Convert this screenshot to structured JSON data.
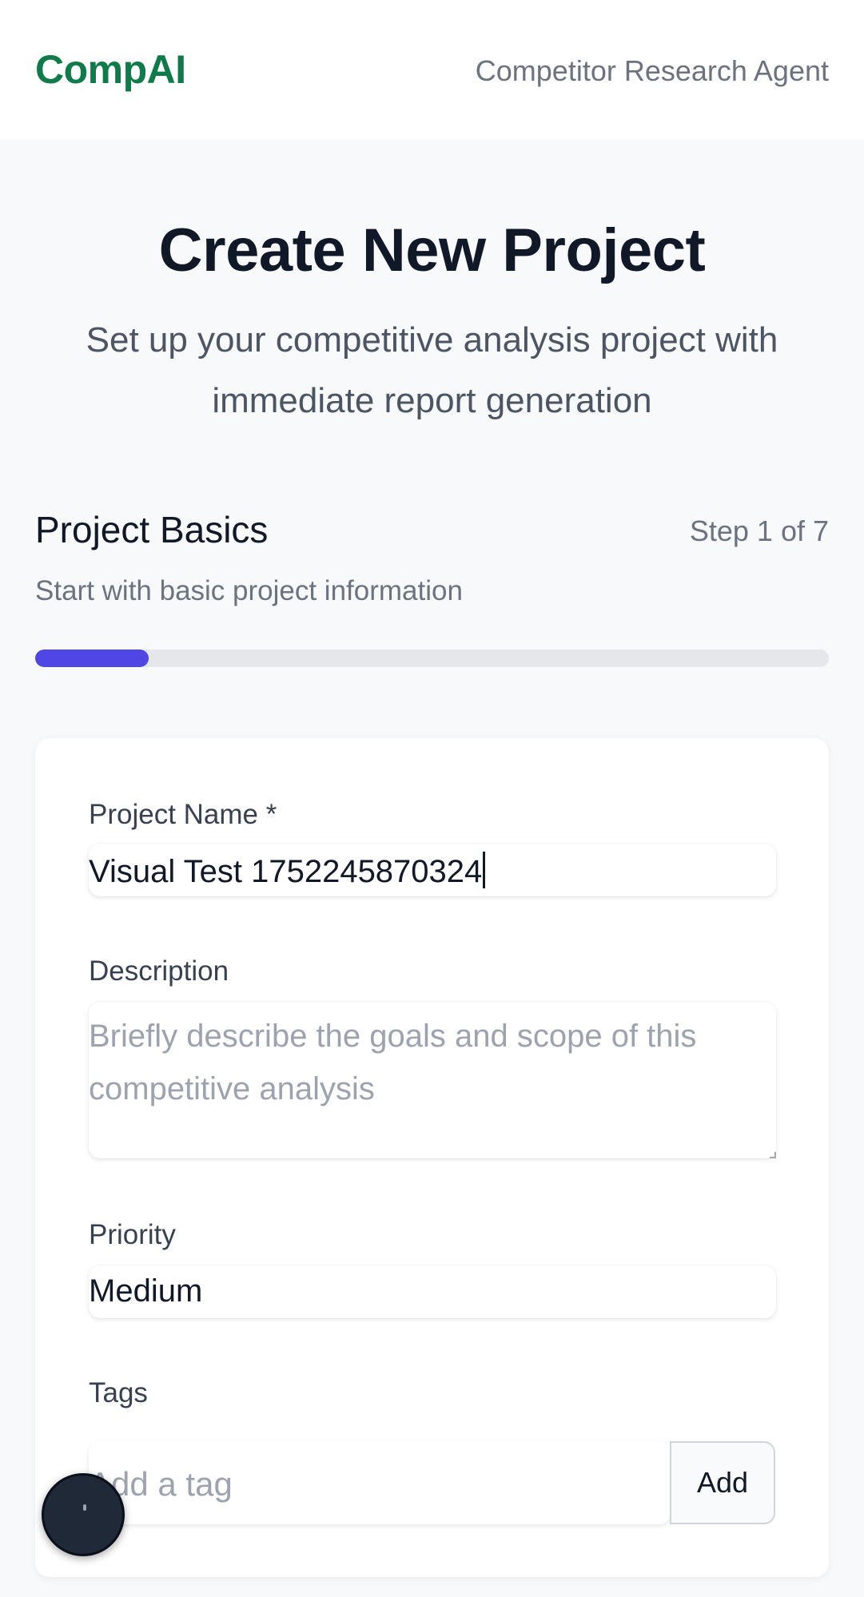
{
  "header": {
    "brand": "CompAI",
    "subtitle": "Competitor Research Agent"
  },
  "hero": {
    "title": "Create New Project",
    "subtitle": "Set up your competitive analysis project with immediate report generation"
  },
  "step": {
    "title": "Project Basics",
    "counter": "Step 1 of 7",
    "description": "Start with basic project information",
    "progress_fraction": 0.143
  },
  "form": {
    "project_name": {
      "label": "Project Name *",
      "value": "Visual Test 1752245870324"
    },
    "description": {
      "label": "Description",
      "placeholder": "Briefly describe the goals and scope of this competitive analysis"
    },
    "priority": {
      "label": "Priority",
      "value": "Medium"
    },
    "tags": {
      "label": "Tags",
      "placeholder": "Add a tag",
      "add_label": "Add"
    }
  },
  "colors": {
    "brand": "#0f7a4a",
    "accent": "#4f46e5"
  }
}
